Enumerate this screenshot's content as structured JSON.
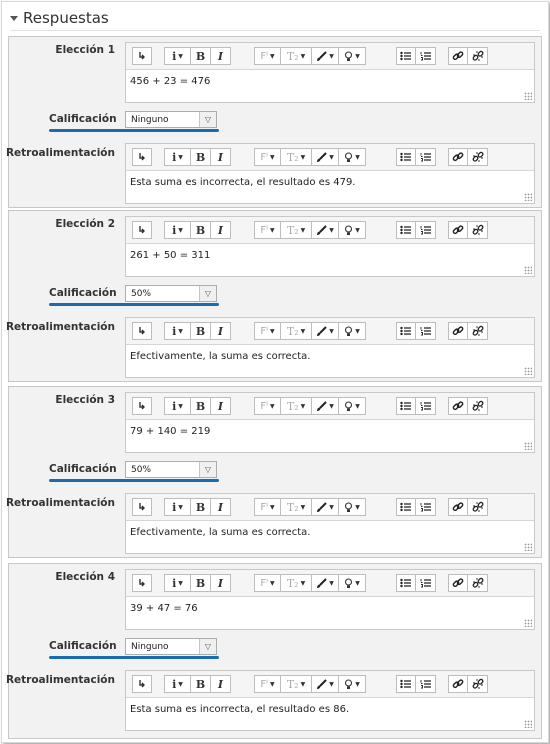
{
  "section": {
    "title": "Respuestas"
  },
  "labels": {
    "grade": "Calificación",
    "feedback": "Retroalimentación"
  },
  "accent": "#1a6cb0",
  "toolbar": {
    "info": "i",
    "bold": "B",
    "italic": "I",
    "font": "Fᴵ",
    "text_style": "T₂"
  },
  "choices": [
    {
      "label": "Elección 1",
      "answer": "456 + 23 = 476",
      "grade": "Ninguno",
      "feedback": "Esta suma es incorrecta, el resultado es 479."
    },
    {
      "label": "Elección 2",
      "answer": "261 + 50 = 311",
      "grade": "50%",
      "feedback": "Efectivamente, la suma es correcta."
    },
    {
      "label": "Elección 3",
      "answer": "79 + 140 = 219",
      "grade": "50%",
      "feedback": "Efectivamente, la suma es correcta."
    },
    {
      "label": "Elección 4",
      "answer": "39 + 47 = 76",
      "grade": "Ninguno",
      "feedback": "Esta suma es incorrecta, el resultado es 86."
    }
  ]
}
